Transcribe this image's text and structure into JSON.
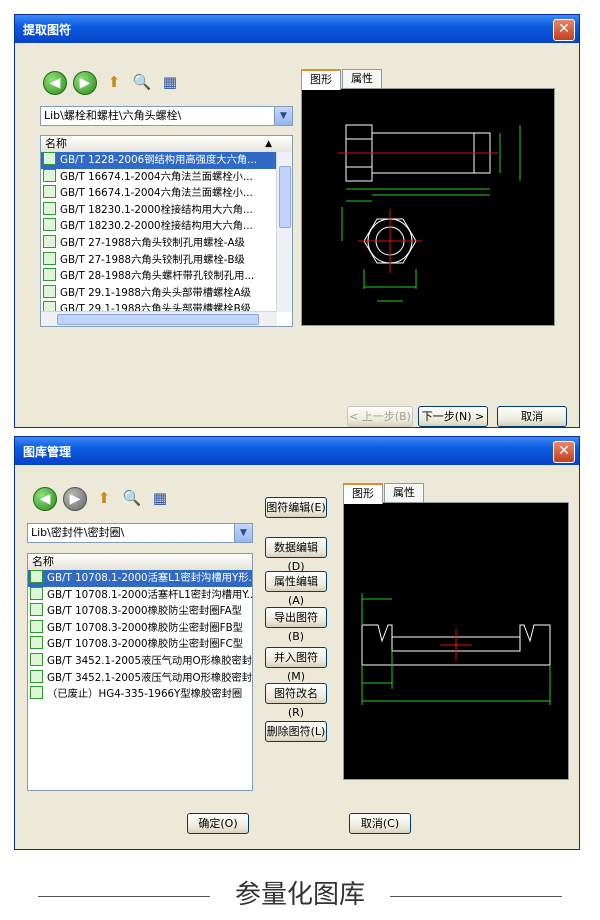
{
  "dialog1": {
    "title": "提取图符",
    "close": "✕",
    "path": "Lib\\螺栓和螺柱\\六角头螺栓\\",
    "list_header": "名称",
    "items": [
      "GB/T 1228-2006钢结构用高强度大六角...",
      "GB/T 16674.1-2004六角法兰面螺栓小...",
      "GB/T 16674.1-2004六角法兰面螺栓小...",
      "GB/T 18230.1-2000栓接结构用大六角...",
      "GB/T 18230.2-2000栓接结构用大六角...",
      "GB/T 27-1988六角头铰制孔用螺栓-A级",
      "GB/T 27-1988六角头铰制孔用螺栓-B级",
      "GB/T 28-1988六角头螺杆带孔铰制孔用...",
      "GB/T 29.1-1988六角头头部带槽螺栓A级",
      "GB/T 29.1-1988六角头头部带槽螺栓B级"
    ],
    "tabs": [
      "图形",
      "属性"
    ],
    "btn_prev": "< 上一步(B)",
    "btn_next": "下一步(N) >",
    "btn_cancel": "取消"
  },
  "dialog2": {
    "title": "图库管理",
    "close": "✕",
    "path": "Lib\\密封件\\密封圈\\",
    "list_header": "名称",
    "items": [
      "GB/T 10708.1-2000活塞L1密封沟槽用Y形...",
      "GB/T 10708.1-2000活塞杆L1密封沟槽用Y...",
      "GB/T 10708.3-2000橡胶防尘密封圈FA型",
      "GB/T 10708.3-2000橡胶防尘密封圈FB型",
      "GB/T 10708.3-2000橡胶防尘密封圈FC型",
      "GB/T 3452.1-2005液压气动用O形橡胶密封...",
      "GB/T 3452.1-2005液压气动用O形橡胶密封...",
      "（已废止）HG4-335-1966Y型橡胶密封圈"
    ],
    "side_buttons": [
      "图符编辑(E)",
      "数据编辑(D)",
      "属性编辑(A)",
      "导出图符(B)",
      "并入图符(M)",
      "图符改名(R)",
      "删除图符(L)"
    ],
    "tabs": [
      "图形",
      "属性"
    ],
    "btn_ok": "确定(O)",
    "btn_cancel": "取消(C)"
  },
  "caption": "参量化图库"
}
